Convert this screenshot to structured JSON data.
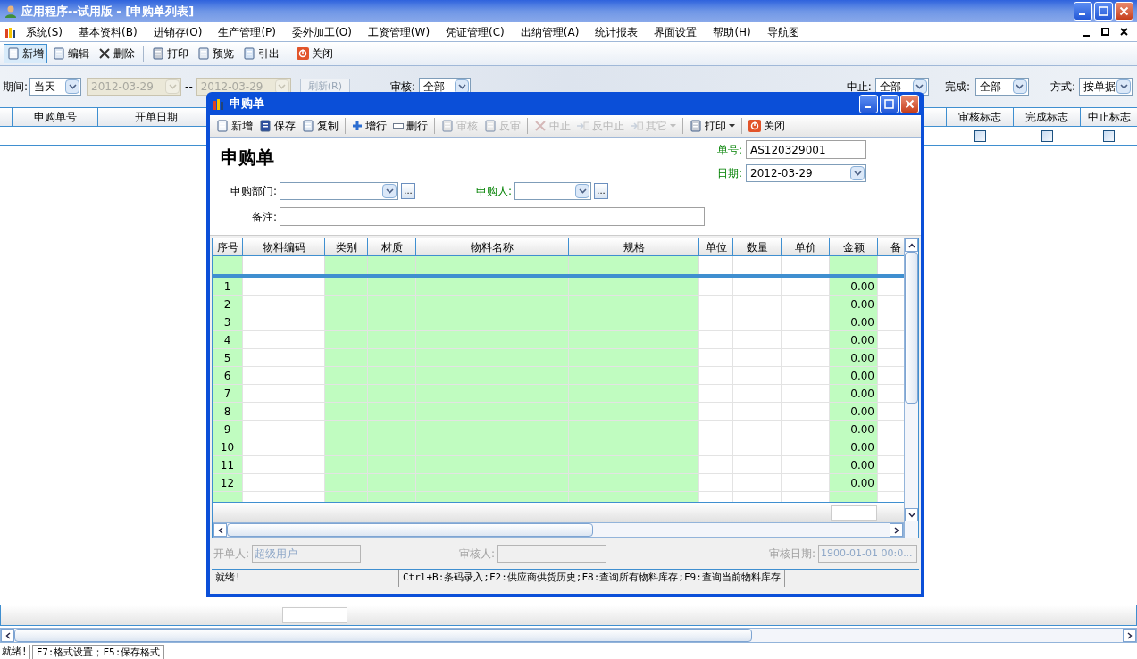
{
  "window": {
    "title": "应用程序--试用版 - [申购单列表]"
  },
  "menu": [
    "系统(S)",
    "基本资料(B)",
    "进销存(O)",
    "生产管理(P)",
    "委外加工(O)",
    "工资管理(W)",
    "凭证管理(C)",
    "出纳管理(A)",
    "统计报表",
    "界面设置",
    "帮助(H)",
    "导航图"
  ],
  "toolbar": [
    {
      "label": "新增",
      "selected": true
    },
    {
      "label": "编辑",
      "selected": false
    },
    {
      "label": "删除",
      "selected": false
    },
    {
      "label": "打印",
      "selected": false
    },
    {
      "label": "预览",
      "selected": false
    },
    {
      "label": "引出",
      "selected": false
    },
    {
      "label": "关闭",
      "selected": false
    }
  ],
  "filters": {
    "period_label": "期间:",
    "period": "当天",
    "date_from": "2012-03-29",
    "date_sep": "--",
    "date_to": "2012-03-29",
    "refresh": "刷新(R)",
    "audit_label": "审核:",
    "audit": "全部",
    "stop_label": "中止:",
    "stop": "全部",
    "done_label": "完成:",
    "done": "全部",
    "mode_label": "方式:",
    "mode": "按单据"
  },
  "list": {
    "columns_left": [
      "申购单号",
      "开单日期"
    ],
    "columns_right": [
      "审核标志",
      "完成标志",
      "中止标志"
    ],
    "rows": [
      {
        "flags": [
          {
            "checked": false
          },
          {
            "checked": false
          },
          {
            "checked": false
          }
        ]
      }
    ]
  },
  "status_bar": [
    "就绪!",
    "F7:格式设置；F5:保存格式"
  ],
  "dialog": {
    "title": "申购单",
    "toolbar": [
      {
        "label": "新增",
        "disabled": false,
        "dropdown": false
      },
      {
        "label": "保存",
        "disabled": false,
        "dropdown": false
      },
      {
        "label": "复制",
        "disabled": false,
        "dropdown": false
      },
      {
        "label": "增行",
        "disabled": false,
        "dropdown": false
      },
      {
        "label": "删行",
        "disabled": false,
        "dropdown": false
      },
      {
        "label": "审核",
        "disabled": true,
        "dropdown": false
      },
      {
        "label": "反审",
        "disabled": true,
        "dropdown": false
      },
      {
        "label": "中止",
        "disabled": true,
        "dropdown": false
      },
      {
        "label": "反中止",
        "disabled": true,
        "dropdown": false
      },
      {
        "label": "其它",
        "disabled": true,
        "dropdown": true
      },
      {
        "label": "打印",
        "disabled": false,
        "dropdown": true
      },
      {
        "label": "关闭",
        "disabled": false,
        "dropdown": false
      }
    ],
    "heading": "申购单",
    "order_no": {
      "label": "单号:",
      "value": "AS120329001",
      "required": true
    },
    "date": {
      "label": "日期:",
      "value": "2012-03-29",
      "required": true
    },
    "department": {
      "label": "申购部门:",
      "button": "...",
      "required": false
    },
    "requester": {
      "label": "申购人:",
      "button": "...",
      "required": true
    },
    "remark": {
      "label": "备注:"
    },
    "grid": {
      "columns": [
        {
          "title": "序号",
          "readonly": true
        },
        {
          "title": "物料编码",
          "readonly": false
        },
        {
          "title": "类别",
          "readonly": true
        },
        {
          "title": "材质",
          "readonly": true
        },
        {
          "title": "物料名称",
          "readonly": true
        },
        {
          "title": "规格",
          "readonly": true
        },
        {
          "title": "单位",
          "readonly": false
        },
        {
          "title": "数量",
          "readonly": false
        },
        {
          "title": "单价",
          "readonly": false
        },
        {
          "title": "金额",
          "readonly": true
        },
        {
          "title": "备",
          "readonly": false
        }
      ],
      "rows": [
        {
          "no": "1",
          "amount": "0.00"
        },
        {
          "no": "2",
          "amount": "0.00"
        },
        {
          "no": "3",
          "amount": "0.00"
        },
        {
          "no": "4",
          "amount": "0.00"
        },
        {
          "no": "5",
          "amount": "0.00"
        },
        {
          "no": "6",
          "amount": "0.00"
        },
        {
          "no": "7",
          "amount": "0.00"
        },
        {
          "no": "8",
          "amount": "0.00"
        },
        {
          "no": "9",
          "amount": "0.00"
        },
        {
          "no": "10",
          "amount": "0.00"
        },
        {
          "no": "11",
          "amount": "0.00"
        },
        {
          "no": "12",
          "amount": "0.00"
        }
      ]
    },
    "creator": {
      "label": "开单人:",
      "value": "超级用户"
    },
    "auditor": {
      "label": "审核人:"
    },
    "audit_date": {
      "label": "审核日期:",
      "value": "1900-01-01 00:0..."
    },
    "status_bar": [
      "就绪!",
      "Ctrl+B:条码录入;F2:供应商供货历史;F8:查询所有物料库存;F9:查询当前物料库存"
    ]
  }
}
